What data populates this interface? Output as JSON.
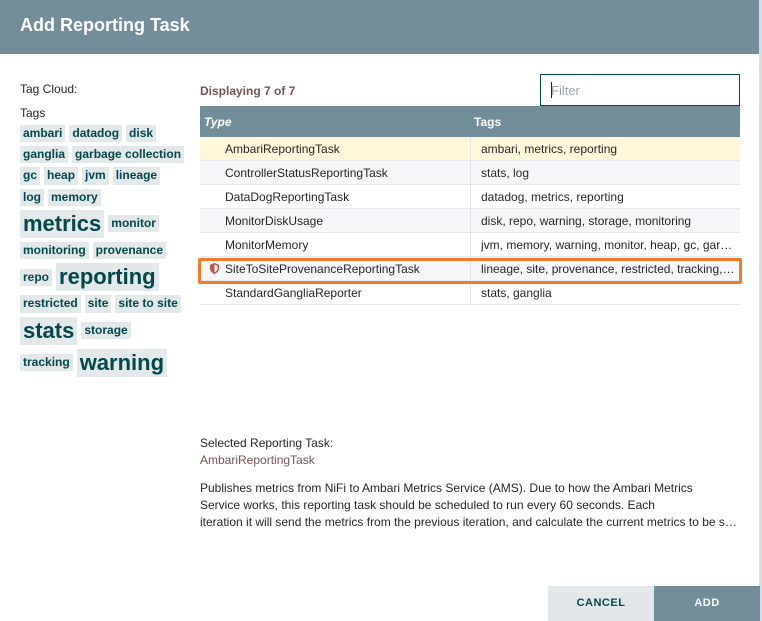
{
  "dialog": {
    "title": "Add Reporting Task"
  },
  "tag_cloud": {
    "heading": "Tag Cloud:",
    "tags_label": "Tags",
    "tags": [
      {
        "label": "ambari",
        "size": 12
      },
      {
        "label": "datadog",
        "size": 12
      },
      {
        "label": "disk",
        "size": 12
      },
      {
        "label": "ganglia",
        "size": 12
      },
      {
        "label": "garbage collection",
        "size": 12
      },
      {
        "label": "gc",
        "size": 12
      },
      {
        "label": "heap",
        "size": 12
      },
      {
        "label": "jvm",
        "size": 12
      },
      {
        "label": "lineage",
        "size": 12
      },
      {
        "label": "log",
        "size": 12
      },
      {
        "label": "memory",
        "size": 12
      },
      {
        "label": "metrics",
        "size": 22
      },
      {
        "label": "monitor",
        "size": 12
      },
      {
        "label": "monitoring",
        "size": 12
      },
      {
        "label": "provenance",
        "size": 12
      },
      {
        "label": "repo",
        "size": 12
      },
      {
        "label": "reporting",
        "size": 22
      },
      {
        "label": "restricted",
        "size": 12
      },
      {
        "label": "site",
        "size": 12
      },
      {
        "label": "site to site",
        "size": 12
      },
      {
        "label": "stats",
        "size": 22
      },
      {
        "label": "storage",
        "size": 12
      },
      {
        "label": "tracking",
        "size": 12
      },
      {
        "label": "warning",
        "size": 22
      }
    ]
  },
  "listing": {
    "displaying": "Displaying 7 of 7",
    "filter_placeholder": "Filter",
    "columns": {
      "type": "Type",
      "tags": "Tags"
    },
    "rows": [
      {
        "type": "AmbariReportingTask",
        "tags": "ambari, metrics, reporting",
        "restricted": false
      },
      {
        "type": "ControllerStatusReportingTask",
        "tags": "stats, log",
        "restricted": false
      },
      {
        "type": "DataDogReportingTask",
        "tags": "datadog, metrics, reporting",
        "restricted": false
      },
      {
        "type": "MonitorDiskUsage",
        "tags": "disk, repo, warning, storage, monitoring",
        "restricted": false
      },
      {
        "type": "MonitorMemory",
        "tags": "jvm, memory, warning, monitor, heap, gc, garbage collection",
        "restricted": false
      },
      {
        "type": "SiteToSiteProvenanceReportingTask",
        "tags": "lineage, site, provenance, restricted, tracking, site to site",
        "restricted": true
      },
      {
        "type": "StandardGangliaReporter",
        "tags": "stats, ganglia",
        "restricted": false
      }
    ]
  },
  "selection": {
    "label": "Selected Reporting Task:",
    "name": "AmbariReportingTask",
    "description_lines": [
      "Publishes metrics from NiFi to Ambari Metrics Service (AMS). Due to how the Ambari Metrics",
      "Service works, this reporting task should be scheduled to run every 60 seconds. Each",
      "iteration it will send the metrics from the previous iteration, and calculate the current metrics to be sent on next iteration."
    ]
  },
  "footer": {
    "cancel_label": "CANCEL",
    "add_label": "ADD"
  },
  "colors": {
    "header": "#728e9b",
    "accent": "#004849",
    "highlight": "#f07c2b",
    "selected_row": "#fff7d7",
    "brand_text": "#775351"
  }
}
